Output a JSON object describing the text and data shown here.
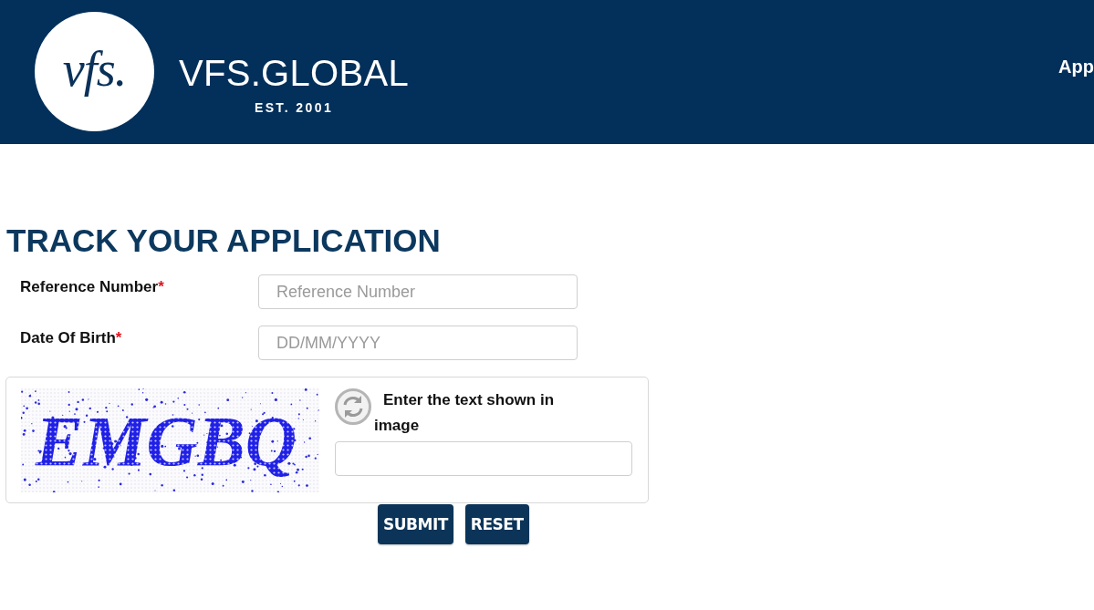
{
  "header": {
    "logo": {
      "mark": "vfs.",
      "name": "VFS.GLOBAL",
      "tagline": "EST. 2001"
    },
    "nav": [
      "App"
    ]
  },
  "page": {
    "title": "TRACK YOUR APPLICATION"
  },
  "form": {
    "fields": [
      {
        "label": "Reference Number",
        "required_mark": "*",
        "placeholder": "Reference Number"
      },
      {
        "label": "Date Of Birth",
        "required_mark": "*",
        "placeholder": "DD/MM/YYYY"
      }
    ],
    "captcha": {
      "text": "EMGBQ",
      "prompt": "Enter the text shown in image"
    },
    "buttons": [
      "SUBMIT",
      "RESET"
    ]
  }
}
